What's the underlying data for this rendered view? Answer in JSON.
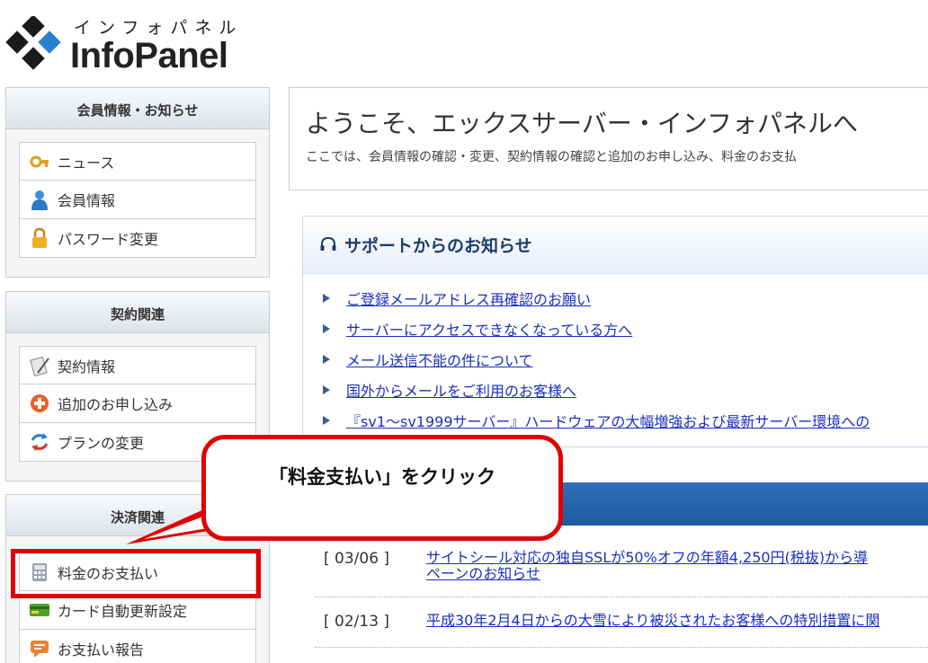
{
  "logo": {
    "kana": "インフォパネル",
    "text": "InfoPanel"
  },
  "sidebar": {
    "sections": [
      {
        "title": "会員情報・お知らせ",
        "items": [
          {
            "label": "ニュース",
            "icon": "news-key-icon"
          },
          {
            "label": "会員情報",
            "icon": "person-icon"
          },
          {
            "label": "パスワード変更",
            "icon": "lock-icon"
          }
        ]
      },
      {
        "title": "契約関連",
        "items": [
          {
            "label": "契約情報",
            "icon": "contract-icon"
          },
          {
            "label": "追加のお申し込み",
            "icon": "plus-circle-icon"
          },
          {
            "label": "プランの変更",
            "icon": "refresh-arrows-icon"
          }
        ]
      },
      {
        "title": "決済関連",
        "items": [
          {
            "label": "料金のお支払い",
            "icon": "calculator-icon"
          },
          {
            "label": "カード自動更新設定",
            "icon": "credit-card-icon"
          },
          {
            "label": "お支払い報告",
            "icon": "speech-bubble-icon"
          }
        ]
      }
    ]
  },
  "welcome": {
    "title": "ようこそ、エックスサーバー・インフォパネルへ",
    "description": "ここでは、会員情報の確認・変更、契約情報の確認と追加のお申し込み、料金のお支払"
  },
  "support": {
    "title": "サポートからのお知らせ",
    "links": [
      "ご登録メールアドレス再確認のお願い",
      "サーバーにアクセスできなくなっている方へ",
      "メール送信不能の件について",
      "国外からメールをご利用のお客様へ",
      "『sv1～sv1999サーバー』ハードウェアの大幅増強および最新サーバー環境への"
    ]
  },
  "news": [
    {
      "date": "[ 03/06 ]",
      "text": "サイトシール対応の独自SSLが50%オフの年額4,250円(税抜)から導",
      "text2": "ペーンのお知らせ"
    },
    {
      "date": "[ 02/13 ]",
      "text": "平成30年2月4日からの大雪により被災されたお客様への特別措置に関"
    }
  ],
  "callout": {
    "text": "「料金支払い」をクリック"
  },
  "colors": {
    "highlight": "#e00000",
    "link": "#1a2fbf",
    "header_blue": "#1f5aa0"
  }
}
